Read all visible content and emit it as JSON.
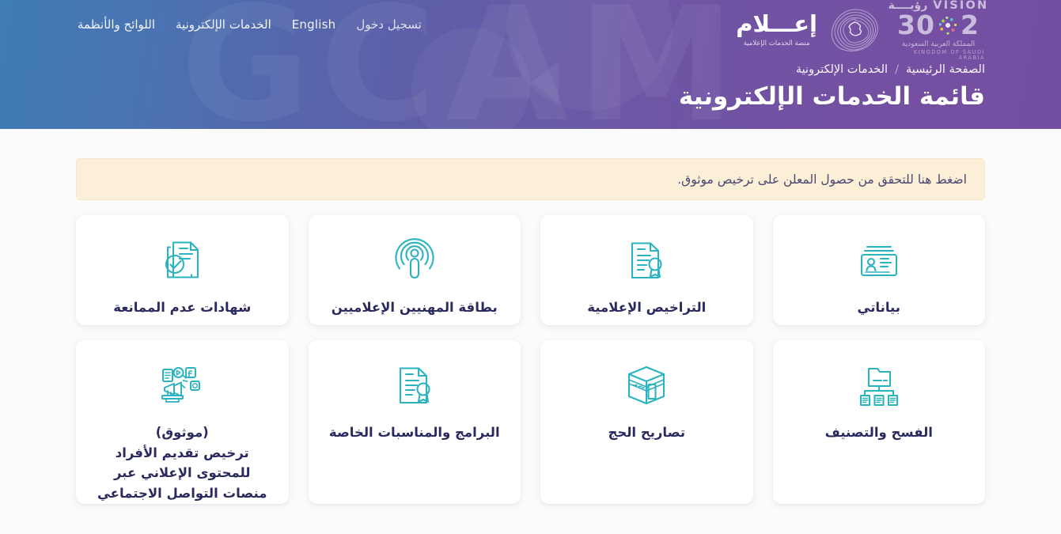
{
  "header": {
    "nav": [
      {
        "label": "اللوائح والأنظمة",
        "name": "nav-regulations"
      },
      {
        "label": "الخدمات الإلكترونية",
        "name": "nav-eservices"
      },
      {
        "label": "English",
        "name": "nav-english"
      },
      {
        "label": "تسجيل دخول",
        "name": "nav-login"
      }
    ],
    "vision_logo": {
      "word_en": "VISION",
      "word_ar": "رؤيــــة",
      "num_left": "2",
      "num_right": "30",
      "kingdom_ar": "المملكة العربية السعودية",
      "kingdom_en": "KINGDOM OF SAUDI ARABIA"
    },
    "brand": {
      "name": "إعـــلام",
      "subtitle": "منصة الخدمات الإعلامية"
    },
    "breadcrumb": {
      "home": "الصفحة الرئيسية",
      "separator": "/",
      "current": "الخدمات الإلكترونية"
    },
    "page_title": "قائمة الخدمات الإلكترونية"
  },
  "notice": {
    "text": "اضغط هنا للتحقق من حصول المعلن على ترخيص موثوق."
  },
  "services": {
    "row1": [
      {
        "title": "بياناتي",
        "icon": "id-card-icon",
        "name": "service-my-data"
      },
      {
        "title": "التراخيص الإعلامية",
        "icon": "certificate-document-icon",
        "name": "service-media-licenses"
      },
      {
        "title": "بطاقة المهنيين الإعلاميين",
        "icon": "microphone-broadcast-icon",
        "name": "service-media-professionals-card"
      },
      {
        "title": "شهادات عدم الممانعة",
        "icon": "document-check-icon",
        "name": "service-no-objection-certificates"
      }
    ],
    "row2": [
      {
        "title": "الفسح والتصنيف",
        "icon": "folder-hierarchy-icon",
        "name": "service-clearance-classification"
      },
      {
        "title": "تصاريح الحج",
        "icon": "kaaba-icon",
        "name": "service-hajj-permits"
      },
      {
        "title": "البرامج والمناسبات الخاصة",
        "icon": "certificate-document-icon",
        "name": "service-programs-special-events"
      },
      {
        "title": "(موثوق)\nترخيص تقديم الأفراد\nللمحتوى الإعلاني عبر\nمنصات التواصل الاجتماعي",
        "icon": "social-ads-megaphone-icon",
        "name": "service-mawthooq-individual-ad-license"
      }
    ]
  },
  "colors": {
    "header_gradient_start": "#3f7cb6",
    "header_gradient_end": "#744ea2",
    "icon_teal": "#2bb3c0",
    "title_navy": "#2b2a5e",
    "notice_bg": "#fcefd8",
    "page_bg": "#fbfbfc"
  }
}
